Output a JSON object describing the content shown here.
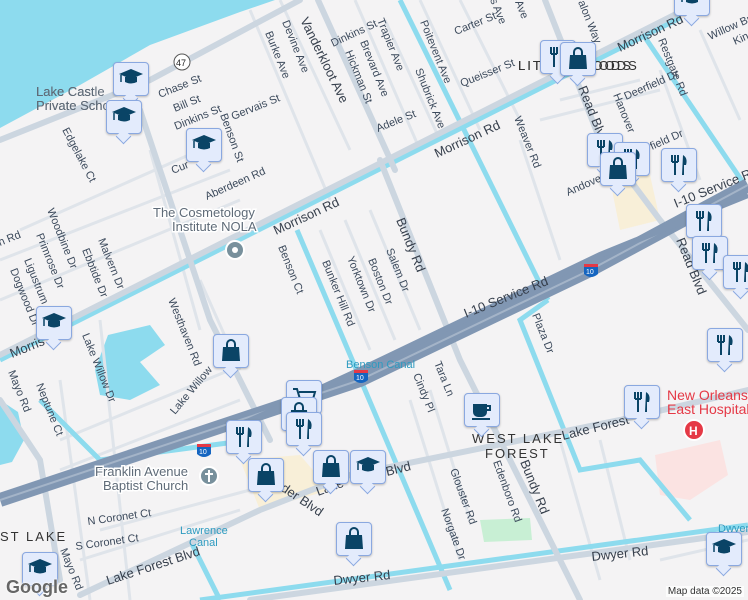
{
  "streets": {
    "vanderkloot": "Vanderkloot Ave",
    "devine": "Devine Ave",
    "burke": "Burke Ave",
    "dinkins1": "Dinkins St",
    "dinkins2": "Dinkins St",
    "hickman": "Hickman St",
    "brevard": "Brevard Ave",
    "trapier": "Trapier Ave",
    "chase": "Chase St",
    "bill": "Bill St",
    "gervais": "Gervais St",
    "benson": "Benson St",
    "cur": "Cur",
    "aberdeen": "Aberdeen Rd",
    "edgelake": "Edgelake Ct",
    "morrison1": "Morrison Rd",
    "morrison2": "Morrison Rd",
    "morrison3": "Morrison Rd",
    "morrison4": "Morris",
    "adele": "Adele St",
    "shubrick": "Shubrick Ave",
    "poitevent": "Poitevent Ave",
    "queisser": "Queisser St",
    "carter": "Carter St",
    "weaver": "Weaver Rd",
    "read1": "Read Blvd",
    "read2": "Read Blvd",
    "hanover": "Hanover",
    "deerfield": "Deerfield Dr",
    "restgate": "Restgate Rd",
    "andover": "Andove",
    "field": "field Dr",
    "willow": "Willow Br",
    "kin": "Kin",
    "i10service1": "I-10 Service Rd",
    "i10service2": "I-10 Service Rd",
    "bundy1": "Bundy Rd",
    "bundy2": "Bundy Rd",
    "salem": "Salem Dr",
    "boston": "Boston Dr",
    "yorktown": "Yorktown Dr",
    "bunkerhill": "Bunker Hill Rd",
    "bensonct": "Benson Ct",
    "malvern": "Malvern Dr",
    "ebbtide": "Ebbtide Dr",
    "woodbine": "Woodbine Dr",
    "primrose": "Primrose Dr",
    "ligustrum": "Ligustrum",
    "dogwood": "Dogwood Dr",
    "anrd": "n Rd",
    "westhaven": "Westhaven Rd",
    "lakewillowdr": "Lake Willow Dr",
    "lakewillow": "Lake Willow",
    "neptune": "Neptune Ct",
    "mayo1": "Mayo Rd",
    "mayo2": "Mayo Rd",
    "plaza": "Plaza Dr",
    "cindy": "Cindy Pl",
    "tara": "Tara Ln",
    "lakeforest1": "Lake Forest",
    "lakeforest2": "Lake Forest Blvd",
    "lakeforest3": "Lake",
    "blvd": "Blvd",
    "alexander": "der Blvd",
    "glouster": "Glouster Rd",
    "edenboro": "Edenboro Rd",
    "norgate": "Norgate Dr",
    "dwyer1": "Dwyer Rd",
    "dwyer2": "Dwyer Rd",
    "ncoronet": "N Coronet Ct",
    "scoronet": "S Coronet Ct",
    "avalon": "alon Way",
    "ave_top1": "Ave",
    "ave_top2": "s Ave"
  },
  "shields": {
    "route47": "47",
    "i10a": "10",
    "i10b": "10",
    "i10c": "10"
  },
  "places": {
    "lake_castle": "Lake Castle Private School",
    "lake_castle_l1": "Lake Cast",
    "lake_castle_l2": "Private Sch",
    "cosmetology_l1": "The Cosmetology",
    "cosmetology_l2": "Institute NOLA",
    "church_l1": "Franklin Avenue",
    "church_l2": "Baptist Church",
    "hospital_l1": "New Orleans",
    "hospital_l2": "East Hospital"
  },
  "areas": {
    "littlewoods": "LITTLE WOODS",
    "littlewoods_shown": "LIT          ODS",
    "wlf1": "WEST LAKE",
    "wlf2": "FOREST",
    "eastlake": "ST LAKE"
  },
  "water": {
    "benson_canal": "Benson Canal",
    "lawrence1": "Lawrence",
    "lawrence2": "Canal",
    "dwyer_canal": "Dwyer"
  },
  "attribution": "Map data ©2025",
  "logo": "Google",
  "colors": {
    "water": "#8ddbee",
    "road": "#d5dde5",
    "highway": "#8197b3",
    "marker_bg": "#e3ebfc",
    "marker_icon": "#0a4466",
    "hospital": "#e53946"
  }
}
